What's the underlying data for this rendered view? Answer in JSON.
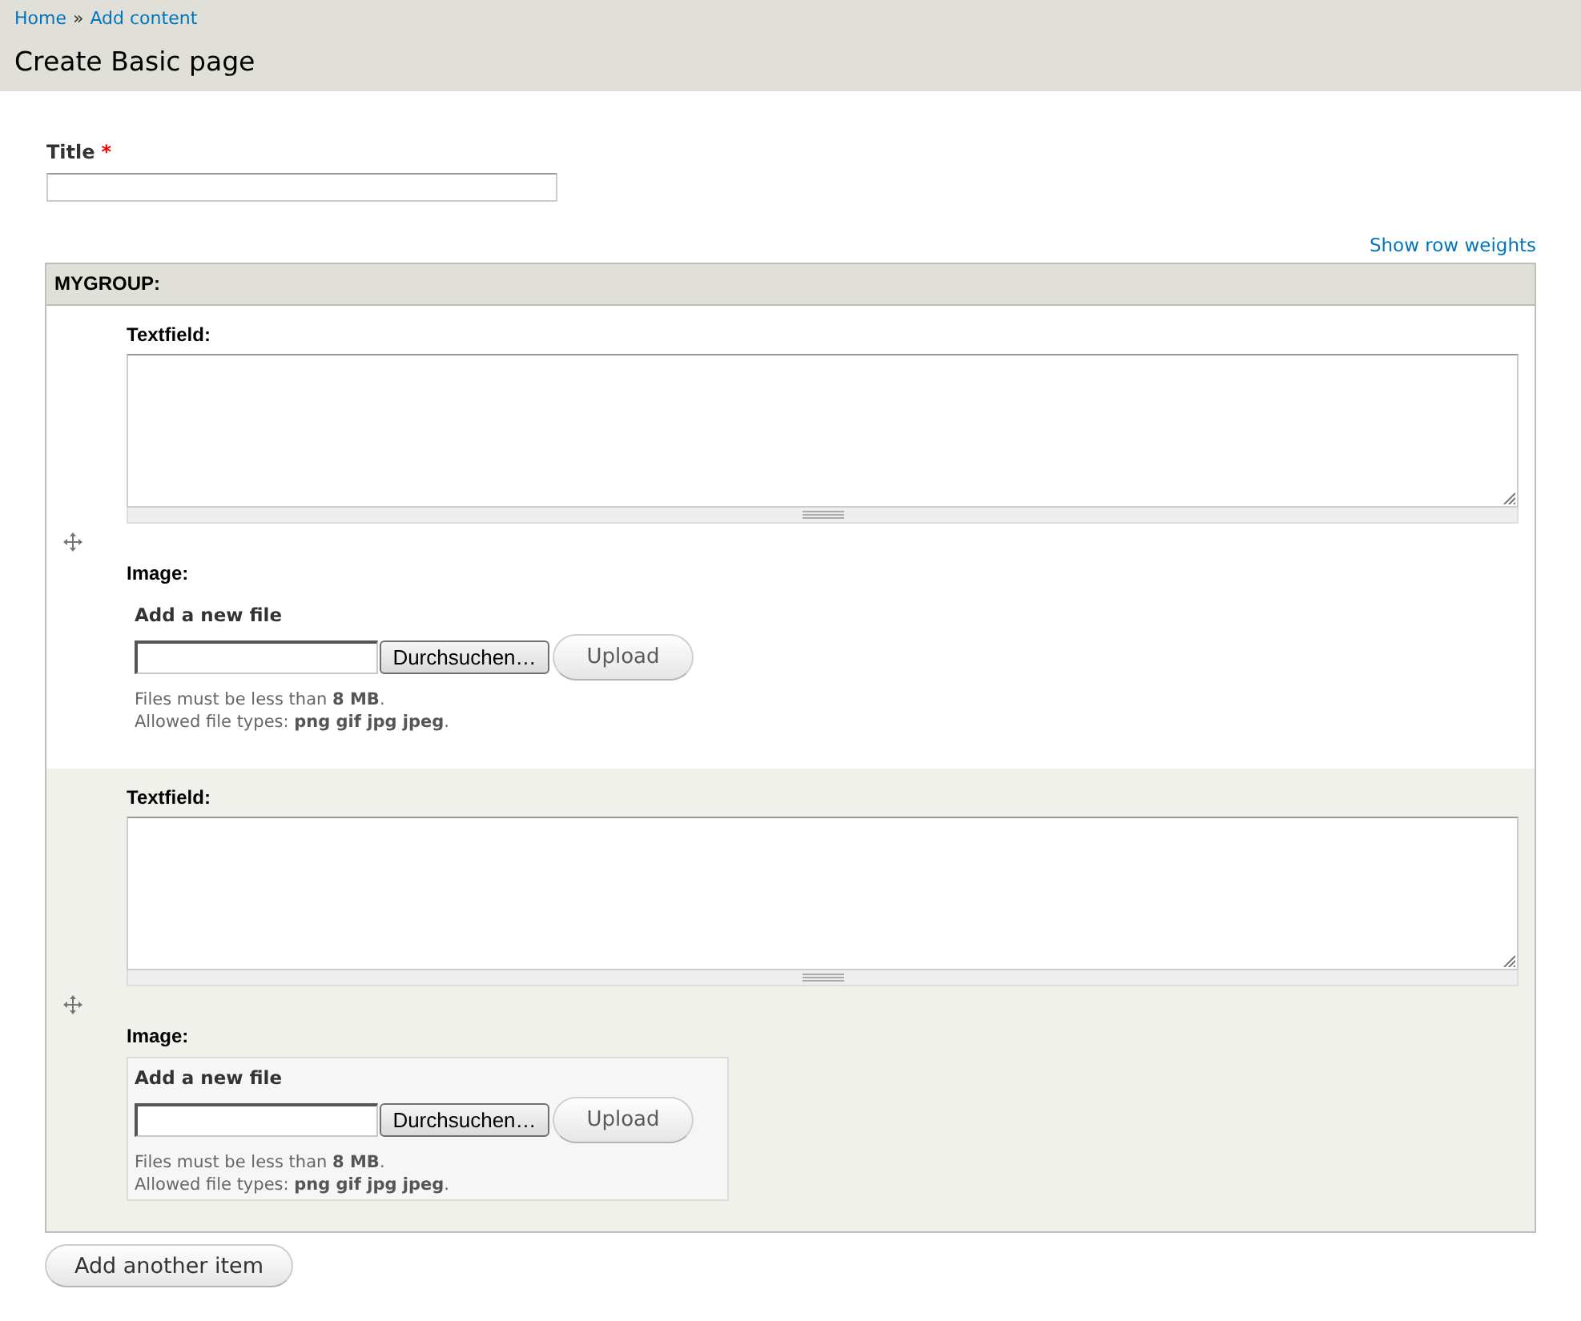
{
  "breadcrumb": {
    "links": [
      "Home",
      "Add content"
    ],
    "separator": "»"
  },
  "page_title": "Create Basic page",
  "title_field": {
    "label": "Title",
    "required_mark": "*"
  },
  "show_row_weights_link": "Show row weights",
  "group": {
    "heading": "MYGROUP:",
    "rows": [
      {
        "textfield_label": "Textfield:",
        "image_label": "Image:",
        "file_widget": {
          "heading": "Add a new file",
          "browse_button": "Durchsuchen…",
          "upload_button": "Upload",
          "help": [
            "Files must be less than **8 MB**.",
            "Allowed file types: **png gif jpg jpeg**."
          ],
          "highlighted": false
        }
      },
      {
        "textfield_label": "Textfield:",
        "image_label": "Image:",
        "file_widget": {
          "heading": "Add a new file",
          "browse_button": "Durchsuchen…",
          "upload_button": "Upload",
          "help": [
            "Files must be less than **8 MB**.",
            "Allowed file types: **png gif jpg jpeg**."
          ],
          "highlighted": true
        }
      }
    ]
  },
  "add_another_button": "Add another item"
}
